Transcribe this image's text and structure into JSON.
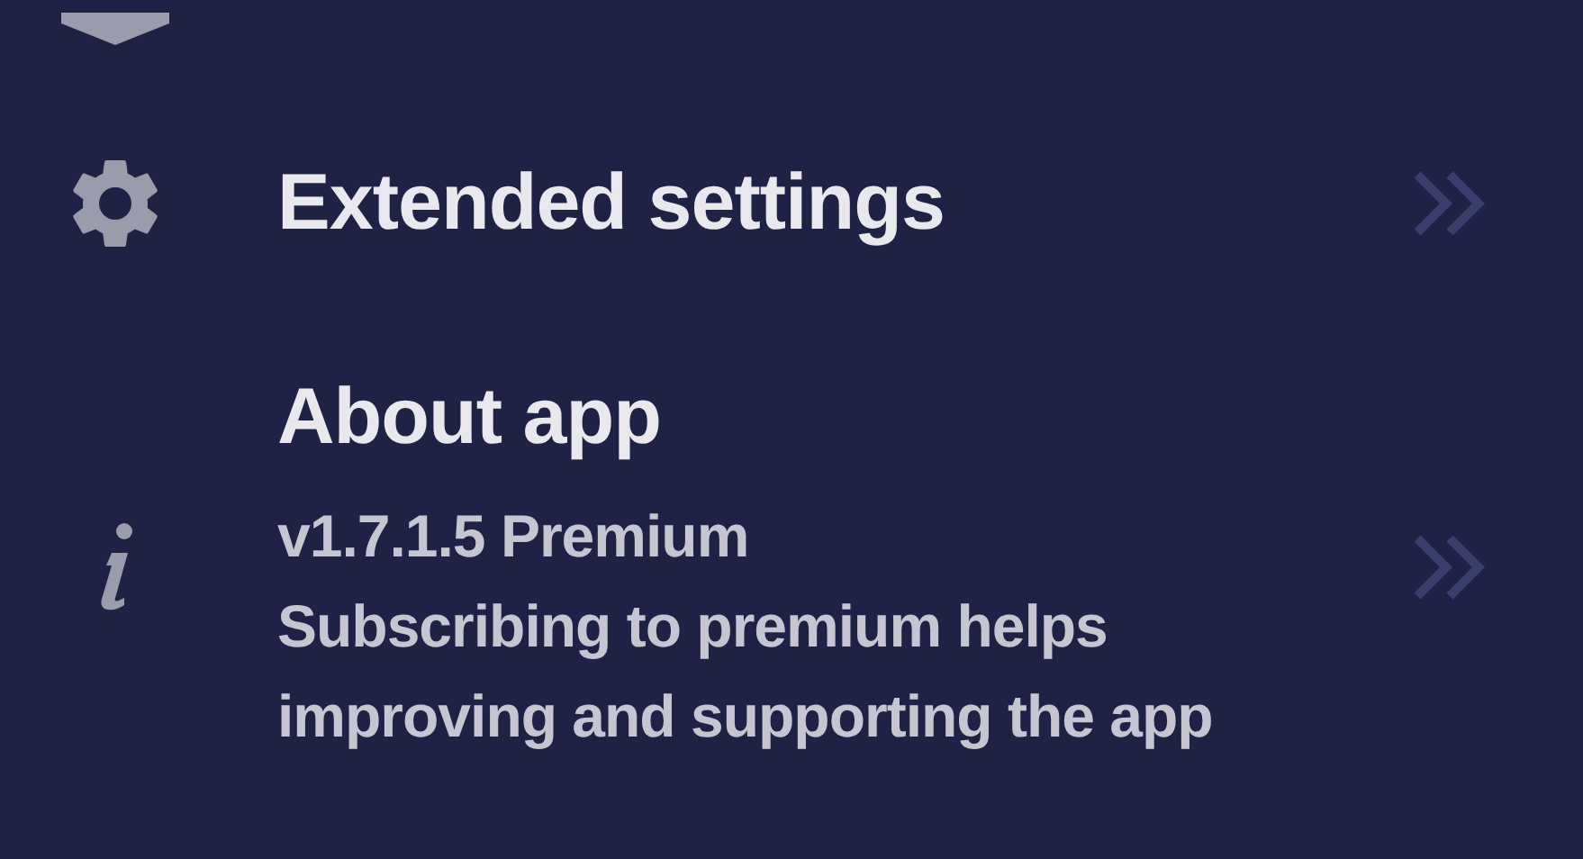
{
  "menu": [
    {
      "kind": "shield"
    },
    {
      "kind": "gear",
      "title": "Extended settings"
    },
    {
      "kind": "info",
      "title": "About app",
      "version": "v1.7.1.5 Premium",
      "description": "Subscribing to premium helps improving and supporting the app"
    }
  ]
}
